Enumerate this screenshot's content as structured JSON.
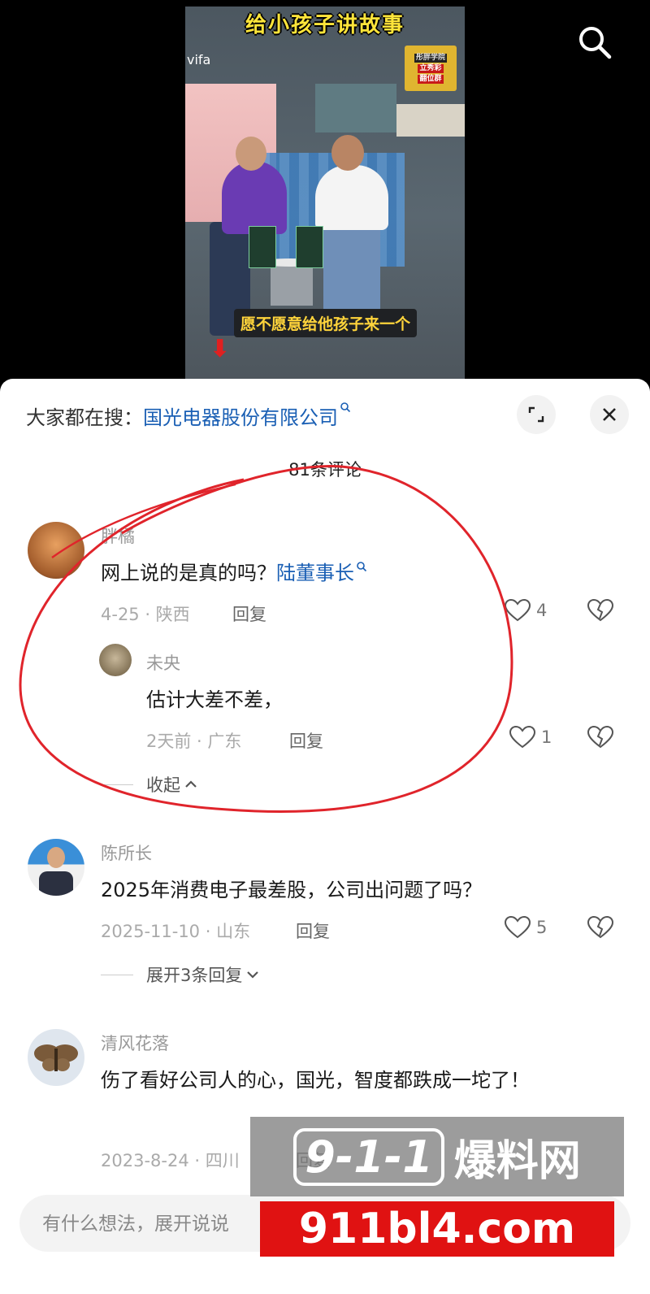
{
  "video": {
    "title": "给小孩子讲故事",
    "brand": "vifa",
    "badge_lines": [
      "彤胖学院",
      "立秀彩",
      "翻位群"
    ],
    "subtitle": "愿不愿意给他孩子来一个"
  },
  "panel": {
    "hot_search_prefix": "大家都在搜：",
    "hot_search_keyword": "国光电器股份有限公司",
    "comment_count": "81条评论"
  },
  "comments": [
    {
      "user": "胖橘",
      "text": "网上说的是真的吗？",
      "mention": "陆董事长",
      "meta": "4-25 · 陕西",
      "reply_label": "回复",
      "likes": "4",
      "replies": [
        {
          "user": "未央",
          "text": "估计大差不差，",
          "meta": "2天前 · 广东",
          "reply_label": "回复",
          "likes": "1"
        }
      ],
      "toggle": "收起"
    },
    {
      "user": "陈所长",
      "text": "2025年消费电子最差股，公司出问题了吗？",
      "meta": "2025-11-10 · 山东",
      "reply_label": "回复",
      "likes": "5",
      "toggle": "展开3条回复"
    },
    {
      "user": "清风花落",
      "text": "伤了看好公司人的心，国光，智度都跌成一坨了！",
      "meta": "2023-8-24 · 四川",
      "reply_label": "回复"
    }
  ],
  "input": {
    "placeholder": "有什么想法，展开说说"
  },
  "watermark": {
    "logo": "9-1-1",
    "name": "爆料网",
    "url": "911bl4.com"
  },
  "colors": {
    "keyword": "#1a5fb4",
    "annotation": "#e0242b",
    "watermark_red": "#e01212"
  }
}
